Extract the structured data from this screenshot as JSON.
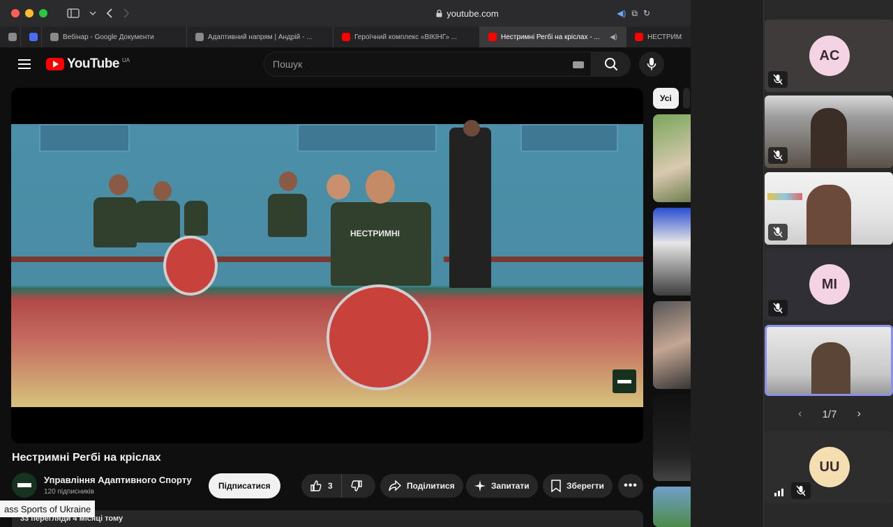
{
  "browser": {
    "url": "youtube.com",
    "tabs": [
      {
        "label": "",
        "favicon": "gray"
      },
      {
        "label": "",
        "favicon": "blue"
      },
      {
        "label": "Вебінар - Google Документи",
        "favicon": "gray"
      },
      {
        "label": "Адаптивний напрям | Андрій - ...",
        "favicon": "gray"
      },
      {
        "label": "Героїчний комплекс «ВІКІНГ» ...",
        "favicon": "red"
      },
      {
        "label": "Нестримні Регбі на кріслах - ...",
        "favicon": "red",
        "active": true
      },
      {
        "label": "НЕСТРИМ",
        "favicon": "red"
      }
    ]
  },
  "youtube": {
    "logo_text": "YouTube",
    "region": "UA",
    "search_placeholder": "Пошук",
    "chips": [
      "Усі"
    ],
    "video": {
      "title": "Нестримні Регбі на кріслах",
      "channel_name": "Управління Адаптивного Спорту",
      "subscribers": "120 підписників",
      "subscribe_label": "Підписатися",
      "likes": "3",
      "share_label": "Поділитися",
      "ask_label": "Запитати",
      "save_label": "Зберегти",
      "shirt_text": "НЕСТРИМНІ",
      "views_line": "33 перегляди  4 місяці тому"
    }
  },
  "caption_overlay": "ass Sports of Ukraine",
  "call": {
    "participants": [
      {
        "initials": "AC",
        "type": "avatar",
        "muted": true
      },
      {
        "initials": "",
        "type": "video",
        "muted": true
      },
      {
        "initials": "",
        "type": "video",
        "muted": true
      },
      {
        "initials": "MI",
        "type": "avatar",
        "muted": true
      },
      {
        "initials": "",
        "type": "video",
        "muted": false,
        "active": true
      },
      {
        "initials": "UU",
        "type": "avatar",
        "muted": true
      }
    ],
    "pager": "1/7"
  },
  "colors": {
    "youtube_red": "#ff0000",
    "active_speaker_border": "#8b8fe8",
    "avatar_pink": "#f3d3e4",
    "avatar_tan": "#f5dfb1"
  }
}
